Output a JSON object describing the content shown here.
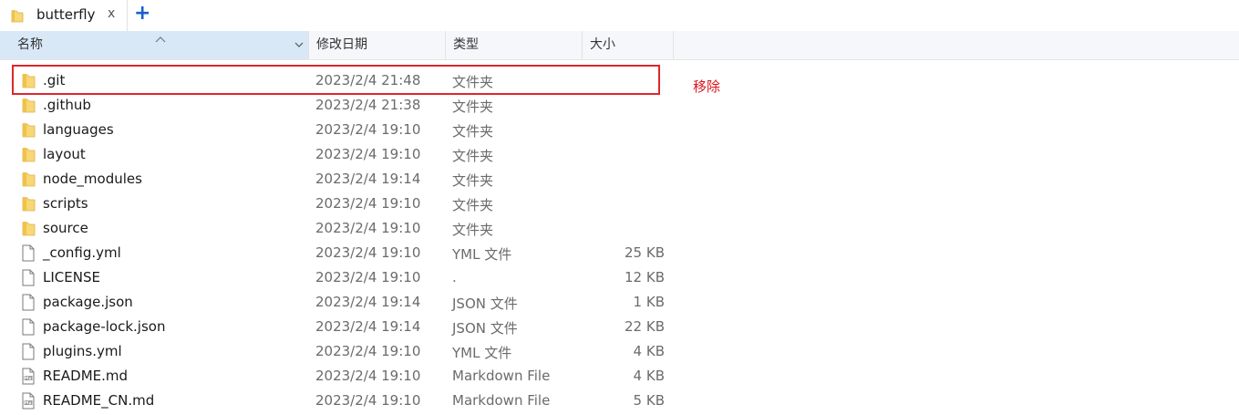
{
  "tab": {
    "title": "butterfly",
    "close_label": "x",
    "new_tab_label": "+"
  },
  "columns": {
    "name": "名称",
    "date": "修改日期",
    "type": "类型",
    "size": "大小"
  },
  "annotation": {
    "text": "移除"
  },
  "files": [
    {
      "name": ".git",
      "date": "2023/2/4 21:48",
      "type": "文件夹",
      "size": "",
      "icon": "folder-icon"
    },
    {
      "name": ".github",
      "date": "2023/2/4 21:38",
      "type": "文件夹",
      "size": "",
      "icon": "folder-icon"
    },
    {
      "name": "languages",
      "date": "2023/2/4 19:10",
      "type": "文件夹",
      "size": "",
      "icon": "folder-icon"
    },
    {
      "name": "layout",
      "date": "2023/2/4 19:10",
      "type": "文件夹",
      "size": "",
      "icon": "folder-icon"
    },
    {
      "name": "node_modules",
      "date": "2023/2/4 19:14",
      "type": "文件夹",
      "size": "",
      "icon": "folder-icon"
    },
    {
      "name": "scripts",
      "date": "2023/2/4 19:10",
      "type": "文件夹",
      "size": "",
      "icon": "folder-icon"
    },
    {
      "name": "source",
      "date": "2023/2/4 19:10",
      "type": "文件夹",
      "size": "",
      "icon": "folder-icon"
    },
    {
      "name": "_config.yml",
      "date": "2023/2/4 19:10",
      "type": "YML 文件",
      "size": "25 KB",
      "icon": "file-icon"
    },
    {
      "name": "LICENSE",
      "date": "2023/2/4 19:10",
      "type": ".",
      "size": "12 KB",
      "icon": "file-icon"
    },
    {
      "name": "package.json",
      "date": "2023/2/4 19:14",
      "type": "JSON 文件",
      "size": "1 KB",
      "icon": "file-icon"
    },
    {
      "name": "package-lock.json",
      "date": "2023/2/4 19:14",
      "type": "JSON 文件",
      "size": "22 KB",
      "icon": "file-icon"
    },
    {
      "name": "plugins.yml",
      "date": "2023/2/4 19:10",
      "type": "YML 文件",
      "size": "4 KB",
      "icon": "file-icon"
    },
    {
      "name": "README.md",
      "date": "2023/2/4 19:10",
      "type": "Markdown File",
      "size": "4 KB",
      "icon": "markdown-file-icon"
    },
    {
      "name": "README_CN.md",
      "date": "2023/2/4 19:10",
      "type": "Markdown File",
      "size": "5 KB",
      "icon": "markdown-file-icon"
    }
  ],
  "colors": {
    "folder": "#f8d775",
    "highlight": "#e0252e",
    "accent": "#1a5fcc",
    "header_selected": "#d9e8f7"
  }
}
